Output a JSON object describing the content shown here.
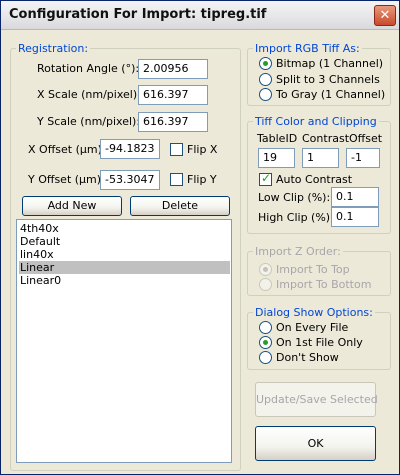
{
  "window": {
    "title": "Configuration For Import: tipreg.tif",
    "close_symbol": "✕"
  },
  "registration": {
    "legend": "Registration:",
    "rotation": {
      "label": "Rotation Angle (°):",
      "value": "2.00956"
    },
    "xscale": {
      "label": "X Scale (nm/pixel):",
      "value": "616.397"
    },
    "yscale": {
      "label": "Y Scale (nm/pixel):",
      "value": "616.397"
    },
    "xoffset": {
      "label": "X Offset (µm):",
      "value": "-94.1823"
    },
    "yoffset": {
      "label": "Y Offset (µm):",
      "value": "-53.3047"
    },
    "flipx": {
      "label": "Flip X",
      "checked": false
    },
    "flipy": {
      "label": "Flip Y",
      "checked": false
    },
    "add_new_label": "Add New",
    "delete_label": "Delete",
    "list": [
      {
        "label": "4th40x",
        "selected": false
      },
      {
        "label": "Default",
        "selected": false
      },
      {
        "label": "lin40x",
        "selected": false
      },
      {
        "label": "Linear",
        "selected": true
      },
      {
        "label": "Linear0",
        "selected": false
      }
    ]
  },
  "import_rgb": {
    "legend": "Import RGB Tiff As:",
    "options": [
      {
        "label": "Bitmap (1 Channel)",
        "selected": true
      },
      {
        "label": "Split to 3 Channels",
        "selected": false
      },
      {
        "label": "To Gray (1 Channel)",
        "selected": false
      }
    ]
  },
  "tiff_color": {
    "legend": "Tiff Color and Clipping",
    "tableid": {
      "label": "TableID",
      "value": "19"
    },
    "contrast": {
      "label": "Contrast",
      "value": "1"
    },
    "offset": {
      "label": "Offset",
      "value": "-1"
    },
    "auto_contrast": {
      "label": "Auto Contrast",
      "checked": true
    },
    "low_clip": {
      "label": "Low Clip (%):",
      "value": "0.1"
    },
    "high_clip": {
      "label": "High Clip (%):",
      "value": "0.1"
    }
  },
  "import_z": {
    "legend": "Import Z Order:",
    "options": [
      {
        "label": "Import To Top",
        "selected": true
      },
      {
        "label": "Import To Bottom",
        "selected": false
      }
    ]
  },
  "dialog_show": {
    "legend": "Dialog Show Options:",
    "options": [
      {
        "label": "On Every File",
        "selected": false
      },
      {
        "label": "On 1st File Only",
        "selected": true
      },
      {
        "label": "Don't Show",
        "selected": false
      }
    ]
  },
  "update_save_label": "Update/Save Selected",
  "ok_label": "OK",
  "colors": {
    "legend": "#0046d5",
    "title_border": "#0a246a",
    "close": "#c94a2a",
    "selection": "#c0c0c0",
    "check": "#21a121"
  }
}
